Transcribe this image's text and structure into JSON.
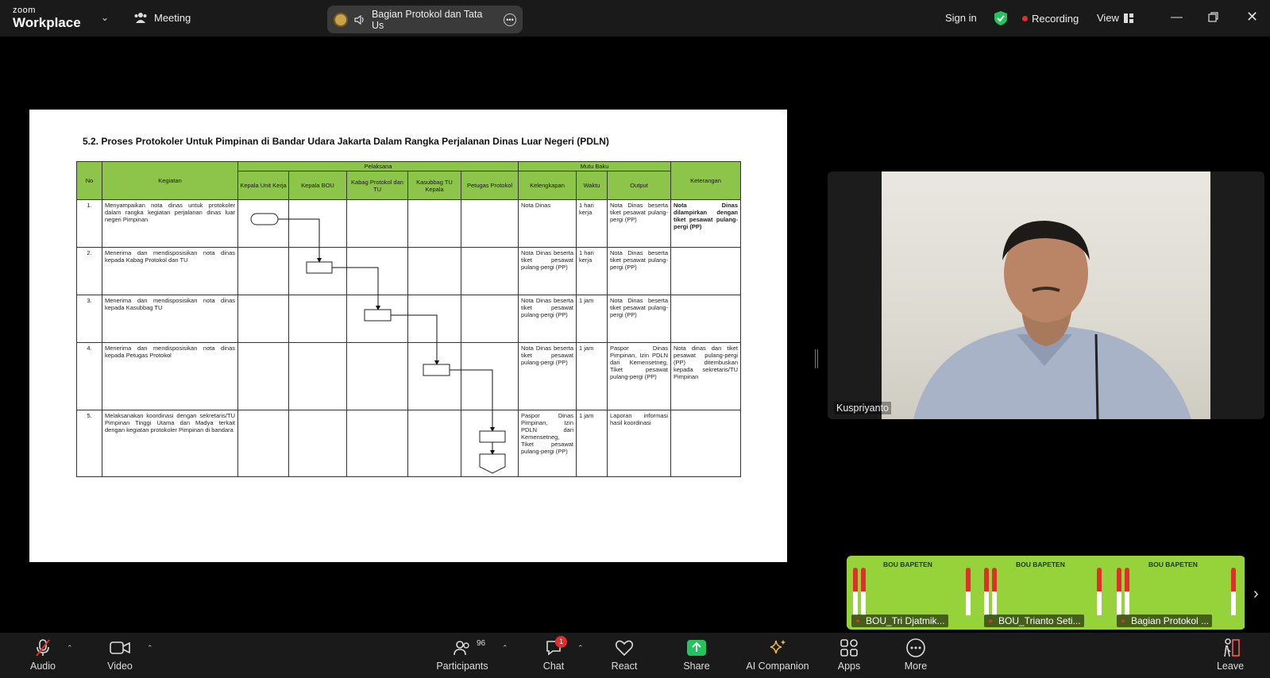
{
  "app": {
    "brand_small": "zoom",
    "brand_large": "Workplace",
    "menu_label": "Meeting"
  },
  "meeting_pill": {
    "title": "Bagian Protokol dan Tata Us"
  },
  "topbar": {
    "sign_in": "Sign in",
    "recording": "Recording",
    "view": "View"
  },
  "document": {
    "title": "5.2. Proses Protokoler Untuk Pimpinan di Bandar Udara Jakarta Dalam Rangka Perjalanan Dinas Luar Negeri (PDLN)",
    "headers": {
      "no": "No",
      "kegiatan": "Kegiatan",
      "pelaksana": "Pelaksana",
      "mutu_baku": "Mutu Baku",
      "keterangan": "Keterangan",
      "roles": [
        "Kepala Unit Kerja",
        "Kepala BOU",
        "Kabag Protokol dan TU",
        "Kasubbag TU Kepala",
        "Petugas Protokol"
      ],
      "mutu": [
        "Kelengkapan",
        "Waktu",
        "Output"
      ]
    },
    "rows": [
      {
        "no": "1.",
        "kegiatan": "Menyampaikan nota dinas untuk protokoler dalam rangka kegiatan perjalanan dinas luar negeri Pimpinan",
        "kelengkapan": "Nota Dinas",
        "waktu": "1 hari kerja",
        "output": "Nota Dinas beserta tiket pesawat pulang-pergi (PP)",
        "keterangan": "Nota Dinas dilampirkan dengan tiket pesawat pulang-pergi (PP)"
      },
      {
        "no": "2.",
        "kegiatan": "Menerima dan mendisposisikan nota dinas kepada Kabag Protokol dan TU",
        "kelengkapan": "Nota Dinas beserta tiket pesawat pulang-pergi (PP)",
        "waktu": "1 hari kerja",
        "output": "Nota Dinas beserta tiket pesawat pulang-pergi (PP)",
        "keterangan": ""
      },
      {
        "no": "3.",
        "kegiatan": "Menerima dan mendisposisikan nota dinas kepada Kasubbag TU",
        "kelengkapan": "Nota Dinas beserta tiket pesawat pulang-pergi (PP)",
        "waktu": "1 jam",
        "output": "Nota Dinas beserta tiket pesawat pulang-pergi (PP)",
        "keterangan": ""
      },
      {
        "no": "4.",
        "kegiatan": "Menerima dan mendisposisikan nota dinas kepada Petugas Protokol",
        "kelengkapan": "Nota Dinas beserta tiket pesawat pulang-pergi (PP)",
        "waktu": "1 jam",
        "output": "Paspor Dinas Pimpinan, Izin PDLN dari Kemensetneg, Tiket pesawat pulang-pergi (PP)",
        "keterangan": "Nota dinas dan tiket pesawat pulang-pergi (PP) ditembuskan kepada sekretaris/TU Pimpinan"
      },
      {
        "no": "5.",
        "kegiatan": "Melaksanakan koordinasi dengan sekretaris/TU Pimpinan Tinggi Utama dan Madya terkait dengan kegiatan protokoler Pimpinan di bandara",
        "kelengkapan": "Paspor Dinas Pimpinan, Izin PDLN dari Kemensetneg, Tiket pesawat pulang-pergi (PP)",
        "waktu": "1 jam",
        "output": "Laporan informasi hasil koordinasi",
        "keterangan": ""
      }
    ]
  },
  "speaker": {
    "name": "Kuspriyanto"
  },
  "thumbnails": [
    {
      "brand": "BOU BAPETEN",
      "name": "BOU_Tri Djatmik..."
    },
    {
      "brand": "BOU BAPETEN",
      "name": "BOU_Trianto Seti..."
    },
    {
      "brand": "BOU BAPETEN",
      "name": "Bagian Protokol ..."
    }
  ],
  "toolbar": {
    "audio": "Audio",
    "video": "Video",
    "participants": "Participants",
    "participants_count": "96",
    "chat": "Chat",
    "chat_badge": "1",
    "react": "React",
    "share": "Share",
    "ai_companion": "AI Companion",
    "apps": "Apps",
    "more": "More",
    "leave": "Leave"
  },
  "colors": {
    "table_header": "#8dc44a",
    "share_green": "#23c45e",
    "recording_red": "#e0302a",
    "ai_gold": "#e8b84a"
  }
}
